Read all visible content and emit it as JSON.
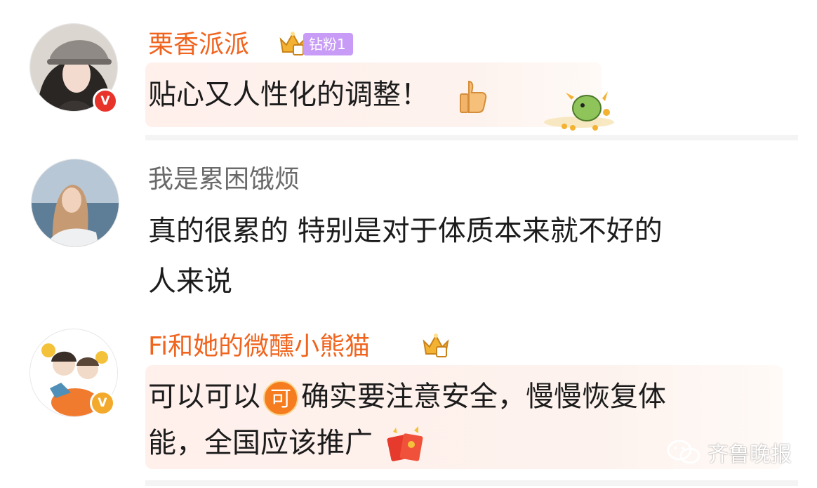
{
  "comments": [
    {
      "username": "栗香派派",
      "fans_tag": "钻粉1",
      "text": "贴心又人性化的调整！",
      "verified_color": "#e8332a",
      "icons": [
        "crown-badge-icon",
        "thumbs-up-emoji-icon",
        "lucky-dragon-sticker-icon"
      ]
    },
    {
      "username": "我是累困饿烦",
      "text_lines": [
        "真的很累的 特别是对于体质本来就不好的",
        "人来说"
      ]
    },
    {
      "username": "Fi和她的微醺小熊猫",
      "text_pre": "可以可以",
      "emoji_label": "可",
      "text_post": "确实要注意安全，慢慢恢复体",
      "text_line2": "能，全国应该推广",
      "verified_color": "#f3a92b",
      "icons": [
        "crown-badge-icon",
        "ke-emoji-icon",
        "red-envelope-emoji-icon"
      ]
    }
  ],
  "watermark": {
    "text": "齐鲁晚报"
  },
  "colors": {
    "username_orange": "#f0641e",
    "username_gray": "#6a6a6a",
    "fans_purple": "#c79bf6"
  }
}
